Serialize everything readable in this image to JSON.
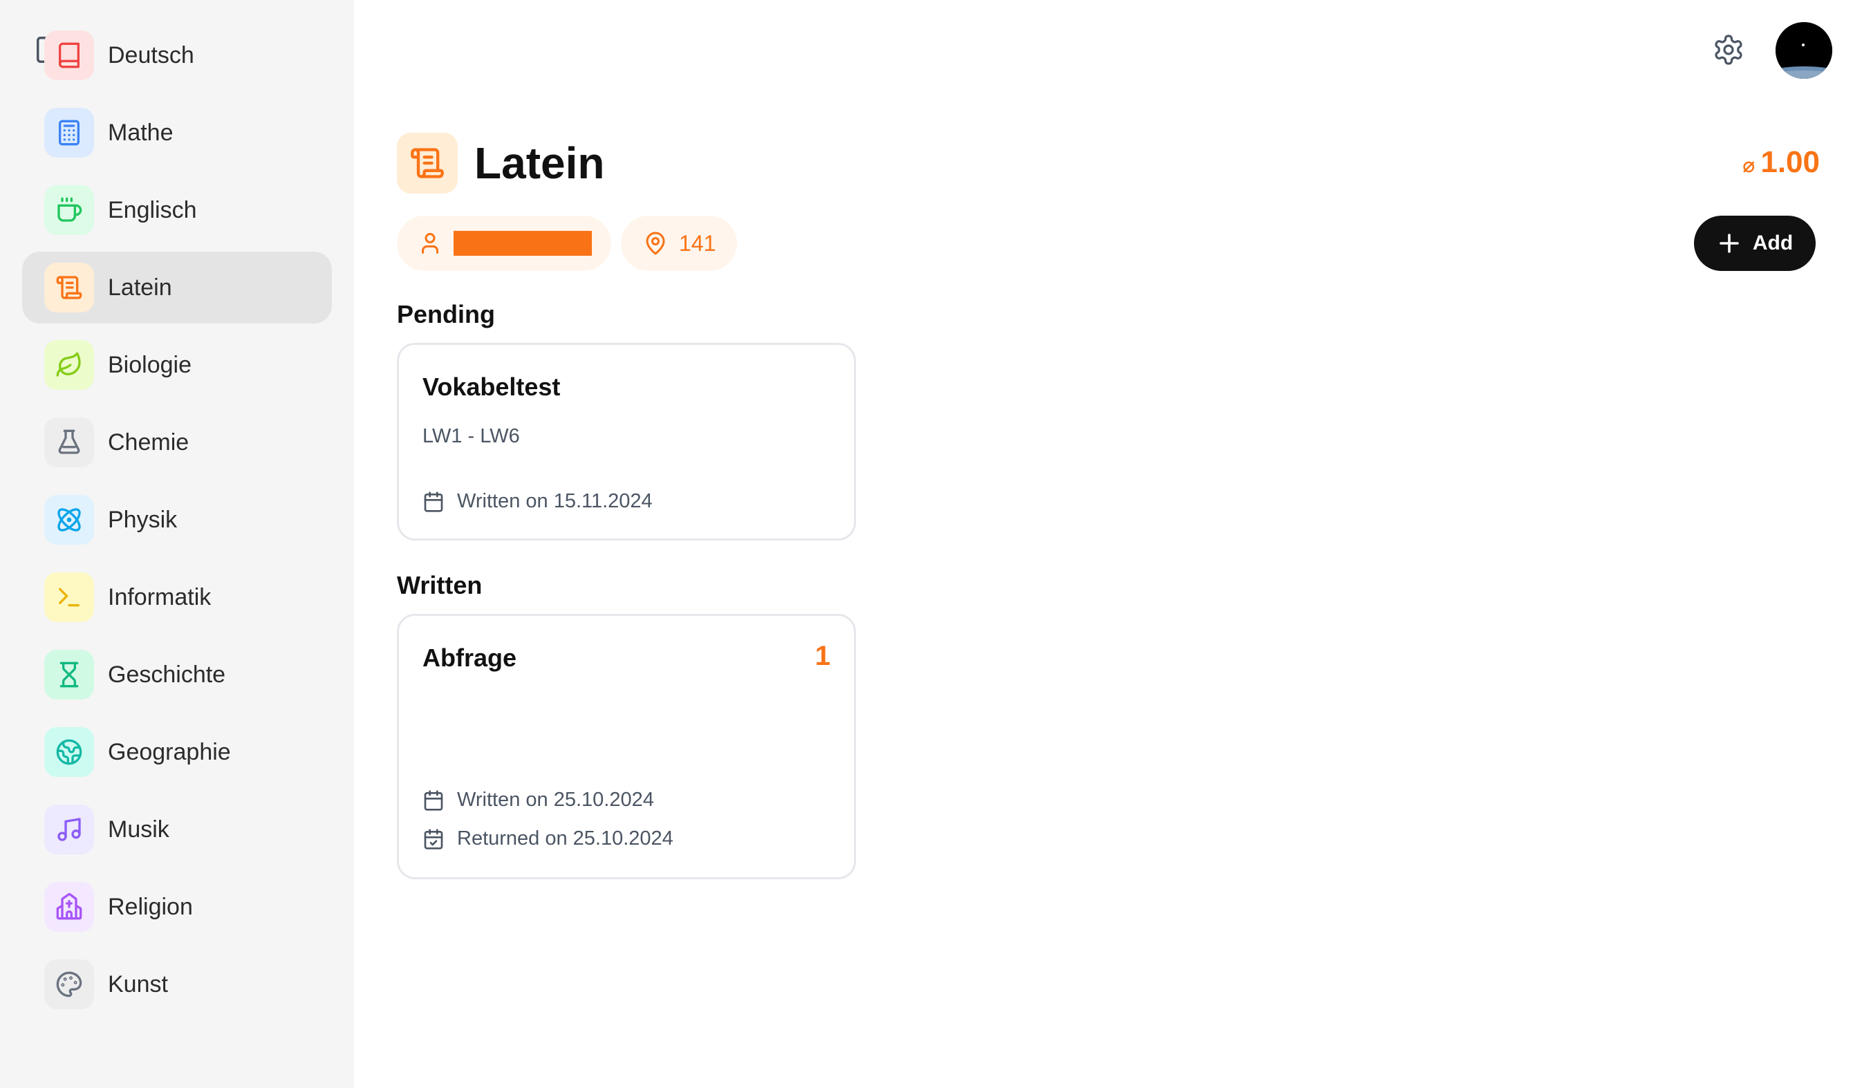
{
  "sidebar": {
    "items": [
      {
        "label": "Deutsch",
        "icon": "book-icon",
        "bg": "#fee2e2",
        "color": "#ef4444"
      },
      {
        "label": "Mathe",
        "icon": "calculator-icon",
        "bg": "#dbeafe",
        "color": "#3b82f6"
      },
      {
        "label": "Englisch",
        "icon": "cup-icon",
        "bg": "#dcfce7",
        "color": "#22c55e"
      },
      {
        "label": "Latein",
        "icon": "scroll-icon",
        "bg": "#ffedd5",
        "color": "#f97316"
      },
      {
        "label": "Biologie",
        "icon": "leaf-icon",
        "bg": "#ecfccb",
        "color": "#84cc16"
      },
      {
        "label": "Chemie",
        "icon": "flask-icon",
        "bg": "#ededed",
        "color": "#6b7280"
      },
      {
        "label": "Physik",
        "icon": "atom-icon",
        "bg": "#e0f2fe",
        "color": "#0ea5e9"
      },
      {
        "label": "Informatik",
        "icon": "terminal-icon",
        "bg": "#fef9c3",
        "color": "#eab308"
      },
      {
        "label": "Geschichte",
        "icon": "hourglass-icon",
        "bg": "#d1fae5",
        "color": "#10b981"
      },
      {
        "label": "Geographie",
        "icon": "globe-icon",
        "bg": "#ccfbf1",
        "color": "#14b8a6"
      },
      {
        "label": "Musik",
        "icon": "music-icon",
        "bg": "#ede9fe",
        "color": "#8b5cf6"
      },
      {
        "label": "Religion",
        "icon": "church-icon",
        "bg": "#f3e8ff",
        "color": "#a855f7"
      },
      {
        "label": "Kunst",
        "icon": "palette-icon",
        "bg": "#ededed",
        "color": "#6b7280"
      }
    ],
    "active_index": 3
  },
  "header": {
    "title": "Latein",
    "average_symbol": "⌀",
    "average": "1.00",
    "room": "141",
    "add_label": "Add"
  },
  "sections": {
    "pending": {
      "title": "Pending",
      "cards": [
        {
          "title": "Vokabeltest",
          "subtitle": "LW1 - LW6",
          "written": "Written on 15.11.2024"
        }
      ]
    },
    "written": {
      "title": "Written",
      "cards": [
        {
          "title": "Abfrage",
          "grade": "1",
          "written": "Written on 25.10.2024",
          "returned": "Returned on 25.10.2024"
        }
      ]
    }
  },
  "colors": {
    "accent": "#f97316",
    "sidebar_bg": "#f5f5f5",
    "active_bg": "#e4e4e4"
  }
}
